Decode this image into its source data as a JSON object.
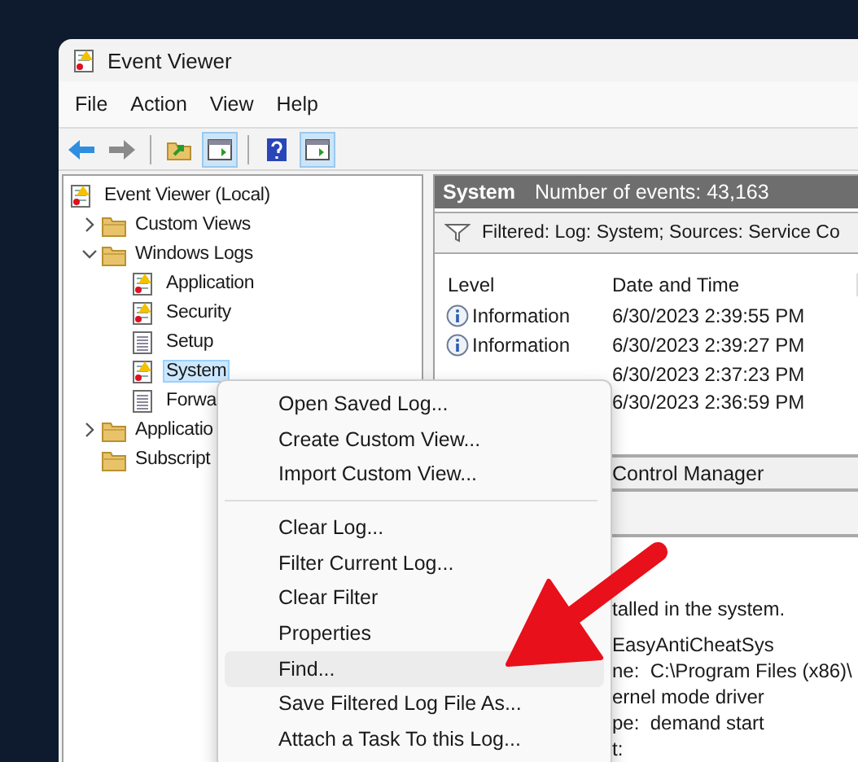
{
  "window": {
    "title": "Event Viewer"
  },
  "menu_bar": [
    "File",
    "Action",
    "View",
    "Help"
  ],
  "toolbar": [
    {
      "kind": "back",
      "disabled": false,
      "pressed": false
    },
    {
      "kind": "forward",
      "disabled": true,
      "pressed": false
    },
    {
      "kind": "separator"
    },
    {
      "kind": "up",
      "disabled": false,
      "pressed": false
    },
    {
      "kind": "pane",
      "disabled": false,
      "pressed": true
    },
    {
      "kind": "separator"
    },
    {
      "kind": "help",
      "disabled": false,
      "pressed": false
    },
    {
      "kind": "pane",
      "disabled": false,
      "pressed": true
    }
  ],
  "tree": [
    {
      "label": "Event Viewer (Local)",
      "kind": "log_warning",
      "selected": false,
      "children": [
        {
          "label": "Custom Views",
          "kind": "folder",
          "expanded": false,
          "selected": false
        },
        {
          "label": "Windows Logs",
          "kind": "folder",
          "expanded": true,
          "selected": false,
          "children": [
            {
              "label": "Application",
              "kind": "log_warning",
              "selected": false
            },
            {
              "label": "Security",
              "kind": "log_warning",
              "selected": false
            },
            {
              "label": "Setup",
              "kind": "log",
              "selected": false
            },
            {
              "label": "System",
              "kind": "log_warning",
              "selected": true
            },
            {
              "label": "Forwa",
              "kind": "log",
              "selected": false
            }
          ]
        },
        {
          "label": "Applicatio",
          "kind": "folder",
          "expanded": false,
          "selected": false
        },
        {
          "label": "Subscript",
          "kind": "folder",
          "selected": false
        }
      ]
    }
  ],
  "log": {
    "name": "System",
    "count": "Number of events: 43,163",
    "filter": "Filtered: Log: System; Sources: Service Co",
    "columns": [
      "Level",
      "Date and Time"
    ],
    "rows": [
      {
        "level": "Information",
        "date": "6/30/2023 2:39:55 PM"
      },
      {
        "level": "Information",
        "date": "6/30/2023 2:39:27 PM"
      },
      {
        "date": "6/30/2023 2:37:23 PM"
      },
      {
        "date": "6/30/2023 2:36:59 PM"
      }
    ]
  },
  "detail": {
    "source": "Control Manager",
    "lines": [
      "talled in the system.",
      "EasyAntiCheatSys",
      "ne:  C:\\Program Files (x86)\\",
      "ernel mode driver",
      "pe:  demand start",
      "t:"
    ]
  },
  "context_menu": [
    {
      "kind": "item",
      "label": "Open Saved Log...",
      "selected": false
    },
    {
      "kind": "item",
      "label": "Create Custom View...",
      "selected": false
    },
    {
      "kind": "item",
      "label": "Import Custom View...",
      "selected": false
    },
    {
      "kind": "separator"
    },
    {
      "kind": "item",
      "label": "Clear Log...",
      "selected": false
    },
    {
      "kind": "item",
      "label": "Filter Current Log...",
      "selected": false
    },
    {
      "kind": "item",
      "label": "Clear Filter",
      "selected": false
    },
    {
      "kind": "item",
      "label": "Properties",
      "selected": false
    },
    {
      "kind": "item",
      "label": "Find...",
      "selected": true
    },
    {
      "kind": "item",
      "label": "Save Filtered Log File As...",
      "selected": false
    },
    {
      "kind": "item",
      "label": "Attach a Task To this Log...",
      "selected": false
    }
  ]
}
